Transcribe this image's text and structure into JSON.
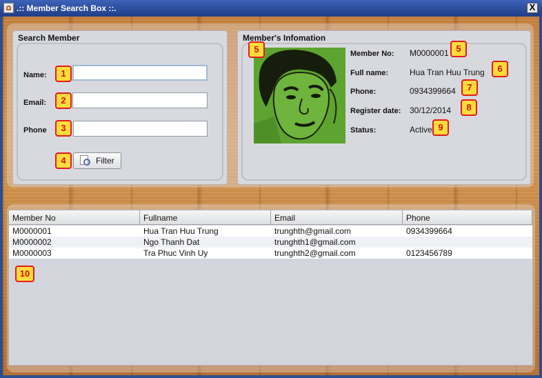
{
  "window": {
    "title": ".:: Member Search Box ::.",
    "close_label": "X"
  },
  "search": {
    "title": "Search Member",
    "name_label": "Name:",
    "email_label": "Email:",
    "phone_label": "Phone",
    "name_value": "",
    "email_value": "",
    "phone_value": "",
    "filter_label": "Filter"
  },
  "info": {
    "title": "Member's Infomation",
    "member_no_label": "Member No:",
    "member_no": "M0000001",
    "fullname_label": "Full name:",
    "fullname": "Hua Tran Huu Trung",
    "phone_label": "Phone:",
    "phone": "0934399664",
    "register_label": "Register date:",
    "register_date": "30/12/2014",
    "status_label": "Status:",
    "status": "Active"
  },
  "annotations": [
    "1",
    "2",
    "3",
    "4",
    "5",
    "5",
    "6",
    "7",
    "8",
    "9",
    "10"
  ],
  "table": {
    "headers": [
      "Member No",
      "Fullname",
      "Email",
      "Phone"
    ],
    "rows": [
      [
        "M0000001",
        "Hua Tran Huu Trung",
        "trunghth@gmail.com",
        "0934399664"
      ],
      [
        "M0000002",
        "Ngo Thanh Dat",
        "trunghth1@gmail.com",
        ""
      ],
      [
        "M0000003",
        "Tra Phuc Vinh Uy",
        "trunghth2@gmail.com",
        "0123456789"
      ]
    ]
  },
  "icons": {
    "window": "java-app-icon",
    "filter": "search-document-icon",
    "close": "close-icon"
  },
  "colors": {
    "badge_fill": "#ffdc3c",
    "badge_border": "#e21c1c",
    "titlebar": "#2a4d9c",
    "photo_bg": "#5fa532"
  }
}
